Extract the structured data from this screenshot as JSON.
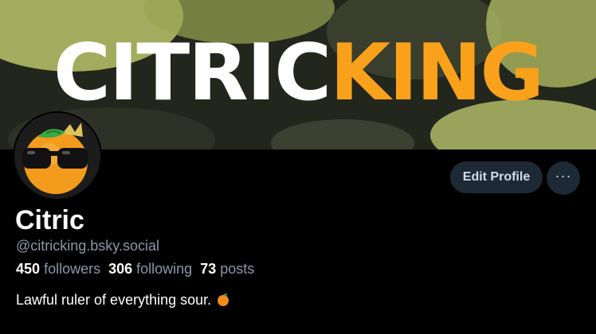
{
  "banner": {
    "title_part1": "CITRIC",
    "title_part2": "KING",
    "accent_color": "#f9a11b"
  },
  "avatar": {
    "icon": "orange-with-sunglasses-and-crown-icon"
  },
  "actions": {
    "edit_profile_label": "Edit Profile",
    "more_label": "···"
  },
  "profile": {
    "display_name": "Citric",
    "handle": "@citricking.bsky.social",
    "followers_count": "450",
    "followers_label": "followers",
    "following_count": "306",
    "following_label": "following",
    "posts_count": "73",
    "posts_label": "posts",
    "bio": "Lawful ruler of everything sour.",
    "bio_emoji": "orange-emoji"
  }
}
